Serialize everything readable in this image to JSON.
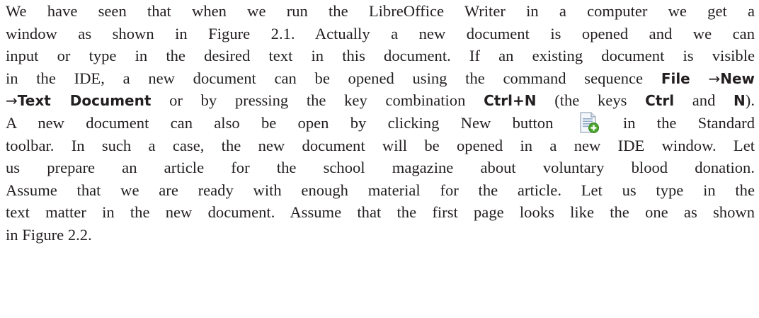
{
  "paragraph": {
    "l1": "We have seen that when we run the LibreOffice Writer in a computer we get a",
    "l2": "window as shown in Figure 2.1. Actually a new document is opened and we can",
    "l3": "input or type in the desired text in this document. If an existing document is visible",
    "l4_text": "in the IDE, a new document can be opened using the command sequence",
    "l4_file": "File",
    "arrow": "→",
    "l4_new": "New",
    "l5_textdoc": "Text Document",
    "l5_mid": " or by pressing the key combination ",
    "l5_ctrln": "Ctrl+N",
    "l5_keys": " (the keys ",
    "l5_ctrl": "Ctrl",
    "l5_and": " and ",
    "l5_n": "N",
    "l5_end": ").",
    "l6_start": "A new document can also be open by clicking New button",
    "l6_end": "in the Standard",
    "l7": "toolbar. In such a case, the new document will be opened in a new IDE window. Let",
    "l8": "us prepare an article for the school magazine about voluntary blood donation.",
    "l9": "Assume that we are ready with enough material for the article. Let us type in the",
    "l10": "text matter in the new document. Assume that the first page looks like the one as shown",
    "l11": "in Figure 2.2."
  },
  "icons": {
    "new_button": "new-document-icon"
  },
  "colors": {
    "text": "#231f20",
    "icon_page": "#f4f7fb",
    "icon_lines": "#8fa9c7",
    "icon_plus": "#4aa52e"
  }
}
